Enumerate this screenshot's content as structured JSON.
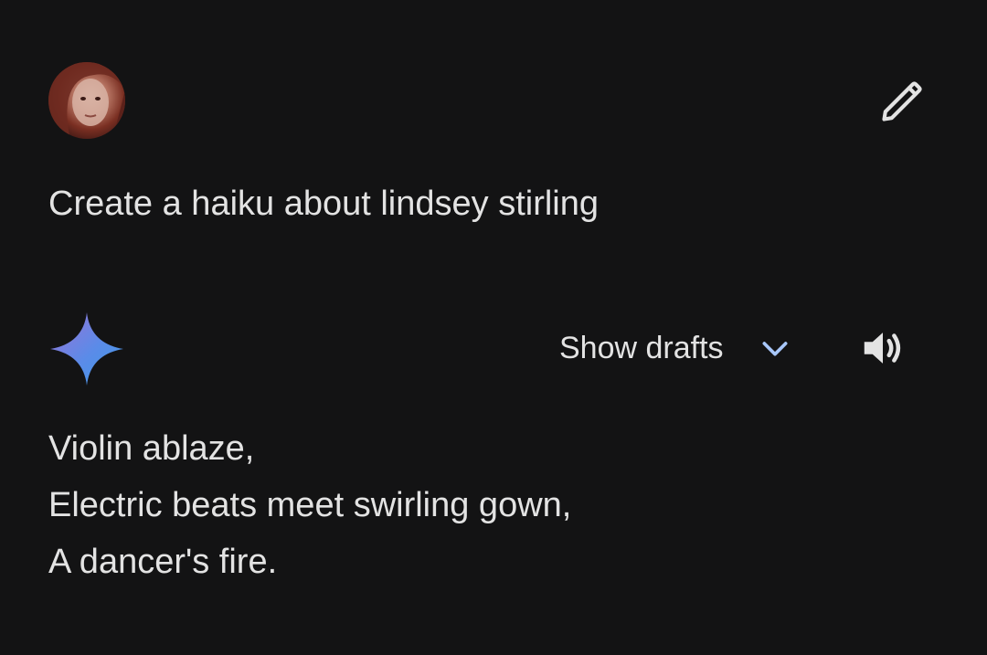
{
  "user": {
    "avatar_icon": "user-avatar-photo"
  },
  "header": {
    "edit_icon": "pencil-icon"
  },
  "prompt": {
    "text": "Create a haiku about lindsey stirling"
  },
  "response": {
    "assistant_icon": "gemini-sparkle-icon",
    "show_drafts_label": "Show drafts",
    "chevron_icon": "chevron-down-icon",
    "speaker_icon": "speaker-icon",
    "lines": [
      "Violin ablaze,",
      "Electric beats meet swirling gown,",
      "A dancer's fire."
    ]
  },
  "colors": {
    "background": "#131314",
    "text": "#e3e3e3",
    "accent_chevron": "#a8c7fa",
    "sparkle_start": "#8a6cd8",
    "sparkle_end": "#4a8fe8"
  }
}
